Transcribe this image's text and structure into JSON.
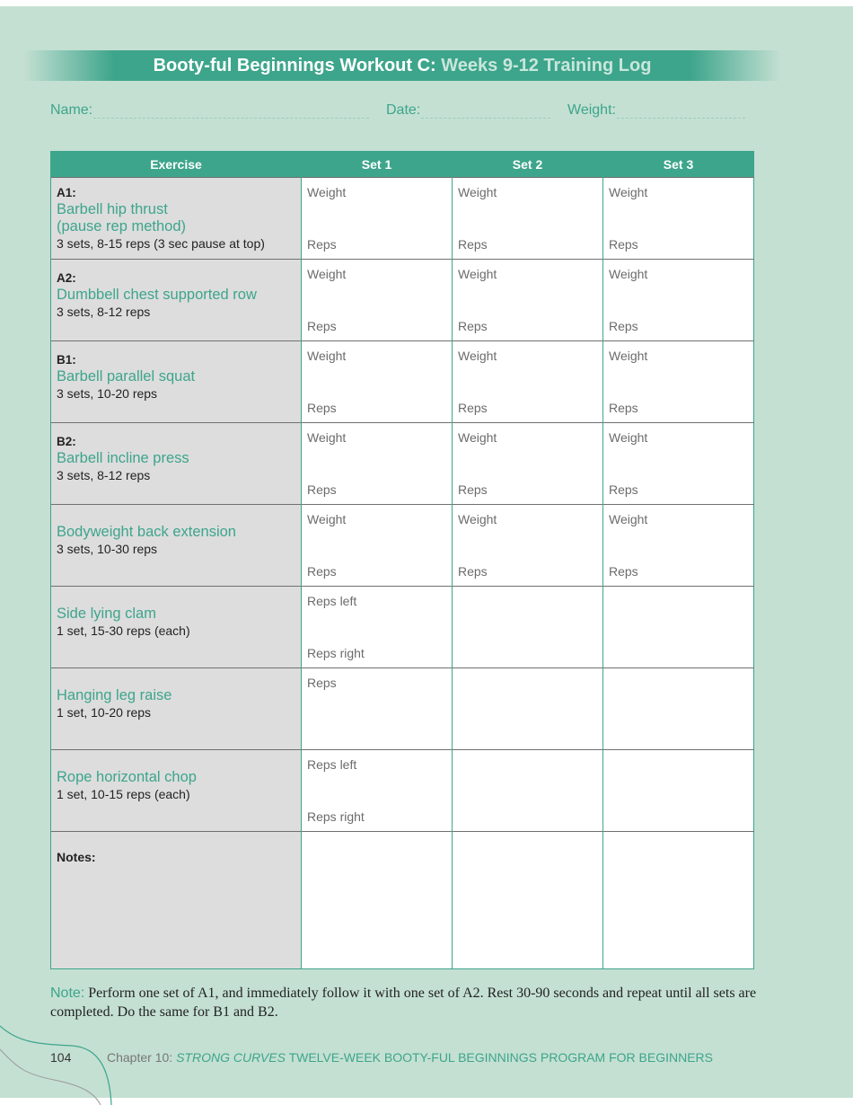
{
  "banner": {
    "title_bold": "Booty-ful Beginnings",
    "title_mid": " Workout C: ",
    "title_light": "Weeks 9-12 Training Log"
  },
  "fields": {
    "name_label": "Name:",
    "date_label": "Date:",
    "weight_label": "Weight:"
  },
  "table": {
    "headers": [
      "Exercise",
      "Set 1",
      "Set 2",
      "Set 3"
    ],
    "rows": [
      {
        "tag": "A1:",
        "name": "Barbell hip thrust (pause rep method)",
        "name_line1": "Barbell hip thrust",
        "name_line2": "(pause rep method)",
        "spec": "3 sets, 8-15 reps (3 sec pause at top)",
        "top_label": "Weight",
        "bottom_label": "Reps"
      },
      {
        "tag": "A2:",
        "name": "Dumbbell chest supported row",
        "spec": "3 sets, 8-12 reps",
        "top_label": "Weight",
        "bottom_label": "Reps"
      },
      {
        "tag": "B1:",
        "name": "Barbell parallel squat",
        "spec": "3 sets, 10-20 reps",
        "top_label": "Weight",
        "bottom_label": "Reps"
      },
      {
        "tag": "B2:",
        "name": "Barbell incline press",
        "spec": "3 sets, 8-12 reps",
        "top_label": "Weight",
        "bottom_label": "Reps"
      },
      {
        "tag": "",
        "name": "Bodyweight back extension",
        "spec": "3 sets, 10-30 reps",
        "top_label": "Weight",
        "bottom_label": "Reps"
      },
      {
        "tag": "",
        "name": "Side lying clam",
        "spec": "1 set, 15-30 reps (each)",
        "top_label": "Reps left",
        "bottom_label": "Reps right"
      },
      {
        "tag": "",
        "name": "Hanging leg raise",
        "spec": "1 set, 10-20 reps",
        "top_label": "Reps",
        "bottom_label": ""
      },
      {
        "tag": "",
        "name": "Rope horizontal chop",
        "spec": "1 set, 10-15 reps (each)",
        "top_label": "Reps left",
        "bottom_label": "Reps right"
      }
    ],
    "notes_label": "Notes:"
  },
  "note": {
    "label": "Note:",
    "text": " Perform one set of A1, and immediately follow it with one set of A2. Rest 30-90 seconds and repeat until all sets are completed. Do the same for B1 and B2."
  },
  "footer": {
    "page_number": "104",
    "chapter_prefix": "Chapter 10: ",
    "chapter_italic": "STRONG CURVES",
    "chapter_rest": " TWELVE-WEEK BOOTY-FUL BEGINNINGS PROGRAM FOR BEGINNERS"
  },
  "colors": {
    "accent": "#3da58b",
    "page_bg": "#c4e0d3",
    "exercise_cell_bg": "#dddddd"
  }
}
